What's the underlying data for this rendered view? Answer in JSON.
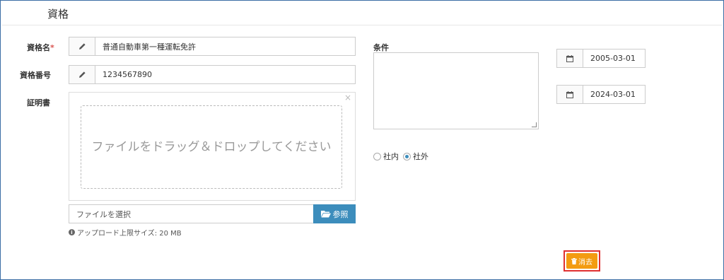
{
  "panel": {
    "title": "資格"
  },
  "form": {
    "name": {
      "label": "資格名",
      "required_mark": "*",
      "value": "普通自動車第一種運転免許",
      "icon": "pencil-icon"
    },
    "number": {
      "label": "資格番号",
      "value": "1234567890",
      "icon": "pencil-icon"
    },
    "certificate": {
      "label": "証明書",
      "dropzone_text": "ファイルをドラッグ＆ドロップしてください",
      "close_glyph": "×",
      "file_placeholder": "ファイルを選択",
      "browse_label": "参照",
      "upload_limit": "アップロード上限サイズ: 20 MB"
    },
    "conditions": {
      "label": "条件",
      "value": ""
    },
    "dates": {
      "start": "2005-03-01",
      "end": "2024-03-01",
      "icon": "calendar-icon"
    },
    "scope": {
      "options": [
        {
          "label": "社内",
          "checked": false
        },
        {
          "label": "社外",
          "checked": true
        }
      ]
    },
    "delete_label": "消去"
  },
  "colors": {
    "primary": "#3c8dbc",
    "warning": "#f39c12",
    "required": "#d9534f",
    "highlight_border": "#e03030"
  }
}
